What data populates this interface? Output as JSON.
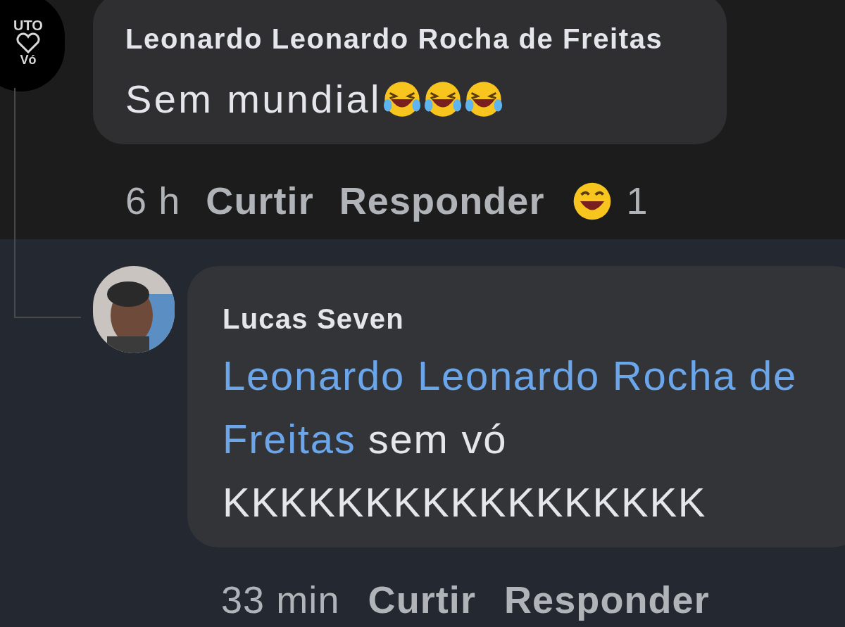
{
  "comment": {
    "avatar_text": [
      "UTO",
      "Vó"
    ],
    "author": "Leonardo Leonardo Rocha de Freitas",
    "text": "Sem mundial",
    "time": "6 h",
    "actions": [
      "Curtir",
      "Responder"
    ],
    "reaction_count": "1"
  },
  "reply": {
    "author": "Lucas Seven",
    "mention_lines": [
      "Leonardo Leonardo Rocha de",
      "Freitas"
    ],
    "text_lines": [
      "sem vó",
      "KKKKKKKKKKKKKKKKK"
    ],
    "time": "33 min",
    "actions": [
      "Curtir",
      "Responder"
    ]
  }
}
